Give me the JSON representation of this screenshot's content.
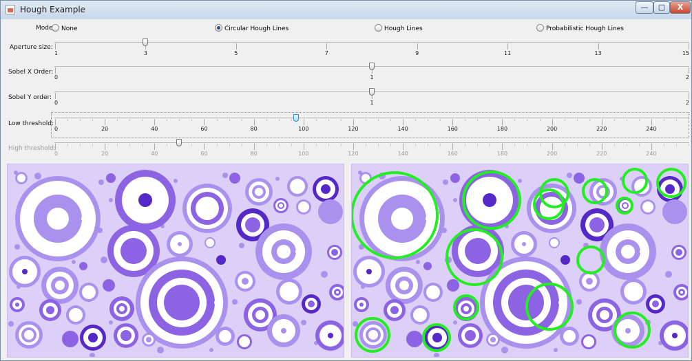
{
  "window": {
    "title": "Hough Example",
    "minimize": "—",
    "maximize": "▢",
    "close": "X"
  },
  "mode": {
    "label": "Mode:",
    "options": [
      {
        "label": "None",
        "selected": false
      },
      {
        "label": "Circular Hough Lines",
        "selected": true
      },
      {
        "label": "Hough Lines",
        "selected": false
      },
      {
        "label": "Probabilistic Hough Lines",
        "selected": false
      }
    ]
  },
  "sliders": [
    {
      "label": "Aperture size:",
      "min": 1,
      "max": 15,
      "value": 3,
      "enabled": true,
      "focused": false,
      "ticks": [
        "1",
        "3",
        "5",
        "7",
        "9",
        "11",
        "13",
        "15"
      ]
    },
    {
      "label": "Sobel X Order:",
      "min": 0,
      "max": 2,
      "value": 1,
      "enabled": true,
      "focused": false,
      "ticks": [
        "0",
        "1",
        "2"
      ]
    },
    {
      "label": "Sobel Y order:",
      "min": 0,
      "max": 2,
      "value": 1,
      "enabled": true,
      "focused": false,
      "ticks": [
        "0",
        "1",
        "2"
      ]
    },
    {
      "label": "Low threshold:",
      "min": 0,
      "max": 255,
      "value": 97,
      "enabled": true,
      "focused": true,
      "ticks": [
        "0",
        "20",
        "40",
        "60",
        "80",
        "100",
        "120",
        "140",
        "160",
        "180",
        "200",
        "220",
        "240"
      ]
    },
    {
      "label": "High threshold:",
      "min": 0,
      "max": 255,
      "value": 50,
      "enabled": false,
      "focused": false,
      "ticks": [
        "0",
        "20",
        "40",
        "60",
        "80",
        "100",
        "120",
        "140",
        "160",
        "180",
        "200",
        "220",
        "240"
      ]
    }
  ],
  "colors": {
    "lavender": "#ddd0f8",
    "light_purple": "#ab91ee",
    "mid_purple": "#8c63e2",
    "dark_purple": "#5528c8",
    "detect": "#22ee22"
  }
}
